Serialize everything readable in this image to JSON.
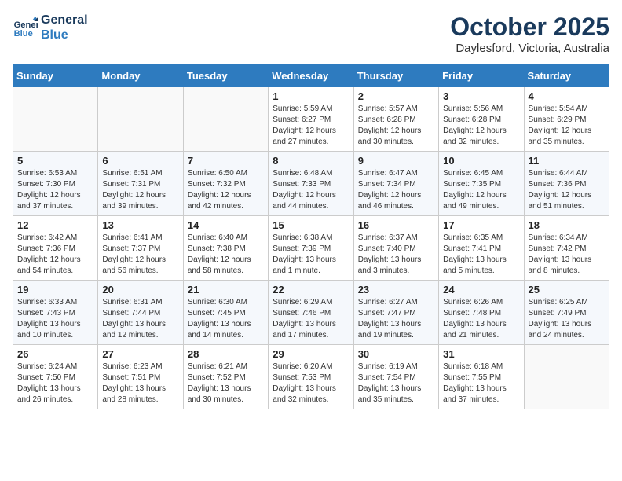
{
  "logo": {
    "line1": "General",
    "line2": "Blue"
  },
  "title": "October 2025",
  "subtitle": "Daylesford, Victoria, Australia",
  "weekdays": [
    "Sunday",
    "Monday",
    "Tuesday",
    "Wednesday",
    "Thursday",
    "Friday",
    "Saturday"
  ],
  "weeks": [
    [
      {
        "day": "",
        "info": ""
      },
      {
        "day": "",
        "info": ""
      },
      {
        "day": "",
        "info": ""
      },
      {
        "day": "1",
        "info": "Sunrise: 5:59 AM\nSunset: 6:27 PM\nDaylight: 12 hours\nand 27 minutes."
      },
      {
        "day": "2",
        "info": "Sunrise: 5:57 AM\nSunset: 6:28 PM\nDaylight: 12 hours\nand 30 minutes."
      },
      {
        "day": "3",
        "info": "Sunrise: 5:56 AM\nSunset: 6:28 PM\nDaylight: 12 hours\nand 32 minutes."
      },
      {
        "day": "4",
        "info": "Sunrise: 5:54 AM\nSunset: 6:29 PM\nDaylight: 12 hours\nand 35 minutes."
      }
    ],
    [
      {
        "day": "5",
        "info": "Sunrise: 6:53 AM\nSunset: 7:30 PM\nDaylight: 12 hours\nand 37 minutes."
      },
      {
        "day": "6",
        "info": "Sunrise: 6:51 AM\nSunset: 7:31 PM\nDaylight: 12 hours\nand 39 minutes."
      },
      {
        "day": "7",
        "info": "Sunrise: 6:50 AM\nSunset: 7:32 PM\nDaylight: 12 hours\nand 42 minutes."
      },
      {
        "day": "8",
        "info": "Sunrise: 6:48 AM\nSunset: 7:33 PM\nDaylight: 12 hours\nand 44 minutes."
      },
      {
        "day": "9",
        "info": "Sunrise: 6:47 AM\nSunset: 7:34 PM\nDaylight: 12 hours\nand 46 minutes."
      },
      {
        "day": "10",
        "info": "Sunrise: 6:45 AM\nSunset: 7:35 PM\nDaylight: 12 hours\nand 49 minutes."
      },
      {
        "day": "11",
        "info": "Sunrise: 6:44 AM\nSunset: 7:36 PM\nDaylight: 12 hours\nand 51 minutes."
      }
    ],
    [
      {
        "day": "12",
        "info": "Sunrise: 6:42 AM\nSunset: 7:36 PM\nDaylight: 12 hours\nand 54 minutes."
      },
      {
        "day": "13",
        "info": "Sunrise: 6:41 AM\nSunset: 7:37 PM\nDaylight: 12 hours\nand 56 minutes."
      },
      {
        "day": "14",
        "info": "Sunrise: 6:40 AM\nSunset: 7:38 PM\nDaylight: 12 hours\nand 58 minutes."
      },
      {
        "day": "15",
        "info": "Sunrise: 6:38 AM\nSunset: 7:39 PM\nDaylight: 13 hours\nand 1 minute."
      },
      {
        "day": "16",
        "info": "Sunrise: 6:37 AM\nSunset: 7:40 PM\nDaylight: 13 hours\nand 3 minutes."
      },
      {
        "day": "17",
        "info": "Sunrise: 6:35 AM\nSunset: 7:41 PM\nDaylight: 13 hours\nand 5 minutes."
      },
      {
        "day": "18",
        "info": "Sunrise: 6:34 AM\nSunset: 7:42 PM\nDaylight: 13 hours\nand 8 minutes."
      }
    ],
    [
      {
        "day": "19",
        "info": "Sunrise: 6:33 AM\nSunset: 7:43 PM\nDaylight: 13 hours\nand 10 minutes."
      },
      {
        "day": "20",
        "info": "Sunrise: 6:31 AM\nSunset: 7:44 PM\nDaylight: 13 hours\nand 12 minutes."
      },
      {
        "day": "21",
        "info": "Sunrise: 6:30 AM\nSunset: 7:45 PM\nDaylight: 13 hours\nand 14 minutes."
      },
      {
        "day": "22",
        "info": "Sunrise: 6:29 AM\nSunset: 7:46 PM\nDaylight: 13 hours\nand 17 minutes."
      },
      {
        "day": "23",
        "info": "Sunrise: 6:27 AM\nSunset: 7:47 PM\nDaylight: 13 hours\nand 19 minutes."
      },
      {
        "day": "24",
        "info": "Sunrise: 6:26 AM\nSunset: 7:48 PM\nDaylight: 13 hours\nand 21 minutes."
      },
      {
        "day": "25",
        "info": "Sunrise: 6:25 AM\nSunset: 7:49 PM\nDaylight: 13 hours\nand 24 minutes."
      }
    ],
    [
      {
        "day": "26",
        "info": "Sunrise: 6:24 AM\nSunset: 7:50 PM\nDaylight: 13 hours\nand 26 minutes."
      },
      {
        "day": "27",
        "info": "Sunrise: 6:23 AM\nSunset: 7:51 PM\nDaylight: 13 hours\nand 28 minutes."
      },
      {
        "day": "28",
        "info": "Sunrise: 6:21 AM\nSunset: 7:52 PM\nDaylight: 13 hours\nand 30 minutes."
      },
      {
        "day": "29",
        "info": "Sunrise: 6:20 AM\nSunset: 7:53 PM\nDaylight: 13 hours\nand 32 minutes."
      },
      {
        "day": "30",
        "info": "Sunrise: 6:19 AM\nSunset: 7:54 PM\nDaylight: 13 hours\nand 35 minutes."
      },
      {
        "day": "31",
        "info": "Sunrise: 6:18 AM\nSunset: 7:55 PM\nDaylight: 13 hours\nand 37 minutes."
      },
      {
        "day": "",
        "info": ""
      }
    ]
  ]
}
